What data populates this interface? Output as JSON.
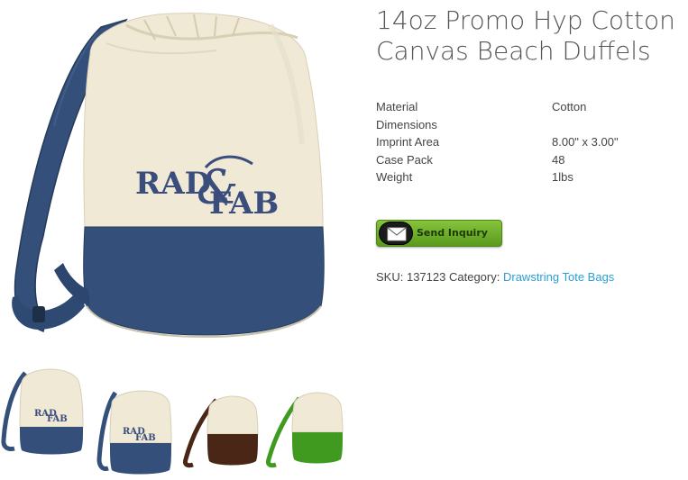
{
  "product": {
    "title_line1": "14oz Promo Hyp Cotton",
    "title_line2": "Canvas Beach Duffels",
    "logo_text_top": "RAD",
    "logo_text_bottom": "FAB",
    "specs": [
      {
        "label": "Material",
        "value": "Cotton"
      },
      {
        "label": "Dimensions",
        "value": ""
      },
      {
        "label": "Imprint Area",
        "value": "8.00\" x 3.00\""
      },
      {
        "label": "Case Pack",
        "value": "48"
      },
      {
        "label": "Weight",
        "value": "1lbs"
      }
    ],
    "inquiry_label": "Send Inquiry",
    "sku_label": "SKU:",
    "sku_value": "137123",
    "category_label": "Category:",
    "category_link": "Drawstring Tote Bags"
  },
  "thumbnails": [
    {
      "name": "natural-navy",
      "trim_color": "#34507a"
    },
    {
      "name": "natural-navy-alt",
      "trim_color": "#34507a"
    },
    {
      "name": "natural-brown",
      "trim_color": "#4a2617"
    },
    {
      "name": "natural-green",
      "trim_color": "#3f9a1f"
    }
  ],
  "colors": {
    "canvas": "#efe9d6",
    "navy": "#34507a",
    "link": "#2a9fd6",
    "button_green": "#6fb12c"
  }
}
